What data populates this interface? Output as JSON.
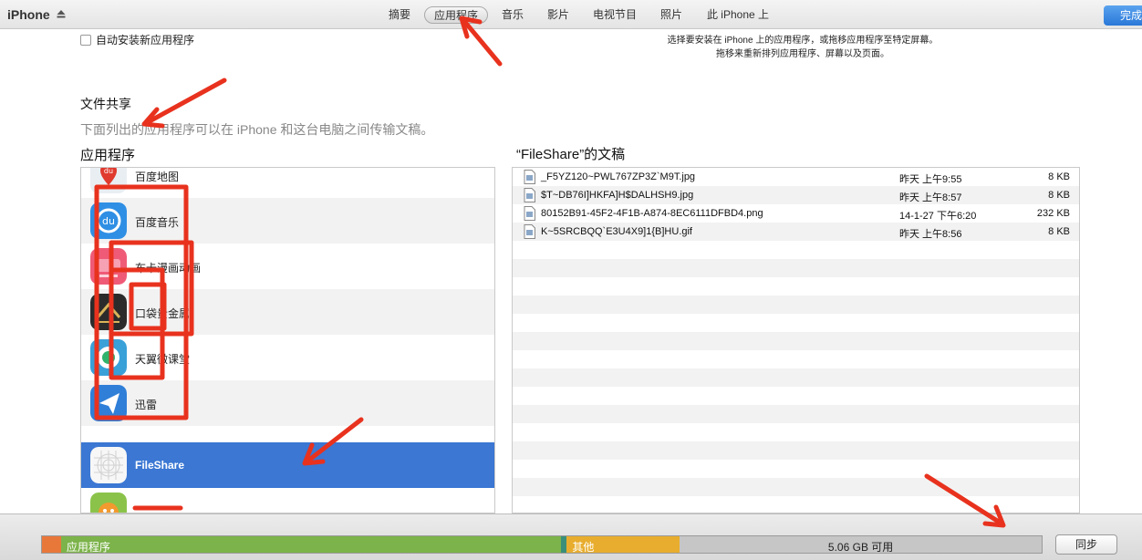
{
  "header": {
    "device": "iPhone",
    "tabs": [
      {
        "label": "摘要",
        "active": false
      },
      {
        "label": "应用程序",
        "active": true
      },
      {
        "label": "音乐",
        "active": false
      },
      {
        "label": "影片",
        "active": false
      },
      {
        "label": "电视节目",
        "active": false
      },
      {
        "label": "照片",
        "active": false
      },
      {
        "label": "此 iPhone 上",
        "active": false
      }
    ],
    "done_label": "完成"
  },
  "apps_panel": {
    "auto_install_label": "自动安装新应用程序",
    "auto_install_checked": false,
    "hint_line1": "选择要安装在 iPhone 上的应用程序，或拖移应用程序至特定屏幕。",
    "hint_line2": "拖移来重新排列应用程序、屏幕以及页面。"
  },
  "file_sharing": {
    "title": "文件共享",
    "description": "下面列出的应用程序可以在 iPhone 和这台电脑之间传输文稿。",
    "apps_heading": "应用程序",
    "docs_heading": "“FileShare”的文稿",
    "apps": [
      {
        "label": "百度地图",
        "icon": "baidu-map-icon",
        "selected": false
      },
      {
        "label": "百度音乐",
        "icon": "baidu-music-icon",
        "selected": false
      },
      {
        "label": "布卡漫画动画",
        "icon": "buka-comics-icon",
        "selected": false
      },
      {
        "label": "口袋贵金属",
        "icon": "koudai-metal-icon",
        "selected": false
      },
      {
        "label": "天翼微课堂",
        "icon": "tianyi-class-icon",
        "selected": false
      },
      {
        "label": "迅雷",
        "icon": "xunlei-icon",
        "selected": false
      },
      {
        "label": "FileShare",
        "icon": "fileshare-icon",
        "selected": true
      },
      {
        "label": "",
        "icon": "alarm-app-icon",
        "selected": false
      }
    ],
    "documents": [
      {
        "name": "_F5YZ120~PWL767ZP3Z`M9T.jpg",
        "date": "昨天 上午9:55",
        "size": "8 KB"
      },
      {
        "name": "$T~DB76I]HKFA]H$DALHSH9.jpg",
        "date": "昨天 上午8:57",
        "size": "8 KB"
      },
      {
        "name": "80152B91-45F2-4F1B-A874-8EC6111DFBD4.png",
        "date": "14-1-27 下午6:20",
        "size": "232 KB"
      },
      {
        "name": "K~5SRCBQQ`E3U4X9]1{B]HU.gif",
        "date": "昨天 上午8:56",
        "size": "8 KB"
      }
    ]
  },
  "footer": {
    "capacity_segments": [
      {
        "label": "",
        "color": "#e8773a",
        "fraction": 0.019
      },
      {
        "label": "应用程序",
        "color": "#7cb34a",
        "fraction": 0.5
      },
      {
        "label": "",
        "color": "#3a8f7a",
        "fraction": 0.006
      },
      {
        "label": "其他",
        "color": "#e8ad2e",
        "fraction": 0.113
      }
    ],
    "free_label": "5.06 GB 可用",
    "free_color": "#c6c6c6",
    "sync_label": "同步"
  },
  "colors": {
    "selection": "#3b77d3",
    "accent_blue": "#2a78d8",
    "annotation_red": "#e8321e"
  }
}
